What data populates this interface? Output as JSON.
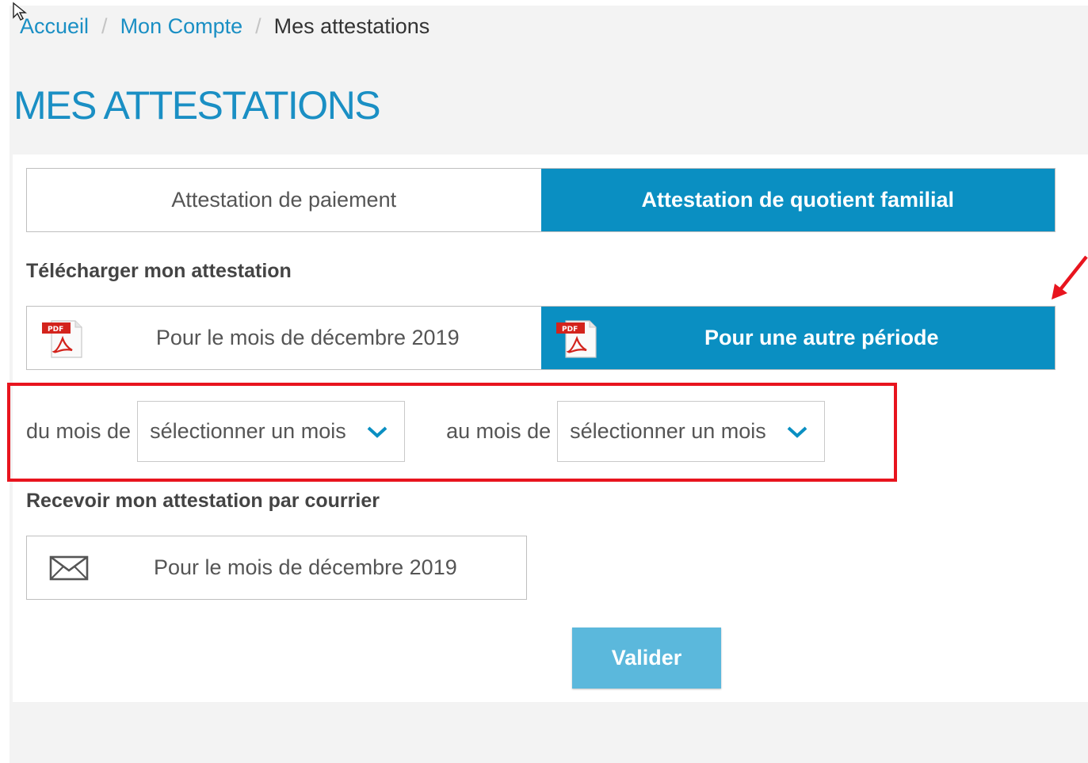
{
  "breadcrumb": {
    "items": [
      {
        "label": "Accueil"
      },
      {
        "label": "Mon Compte"
      },
      {
        "label": "Mes attestations"
      }
    ],
    "separator": "/"
  },
  "page_title": "MES ATTESTATIONS",
  "tabs": [
    {
      "label": "Attestation de paiement",
      "active": false
    },
    {
      "label": "Attestation de quotient familial",
      "active": true
    }
  ],
  "download": {
    "section_label": "Télécharger mon attestation",
    "options": [
      {
        "label": "Pour le mois de décembre 2019",
        "icon": "pdf-icon",
        "active": false
      },
      {
        "label": "Pour une autre période",
        "icon": "pdf-icon",
        "active": true
      }
    ]
  },
  "period": {
    "from_label": "du mois de",
    "from_select": "sélectionner un mois",
    "to_label": "au mois de",
    "to_select": "sélectionner un mois"
  },
  "mail": {
    "section_label": "Recevoir mon attestation par courrier",
    "option_label": "Pour le mois de décembre 2019",
    "icon": "envelope-icon"
  },
  "submit_label": "Valider",
  "colors": {
    "primary": "#0a8fc2",
    "link": "#1a8fc4",
    "button": "#5bb8dc",
    "annotation": "#e8141e"
  }
}
